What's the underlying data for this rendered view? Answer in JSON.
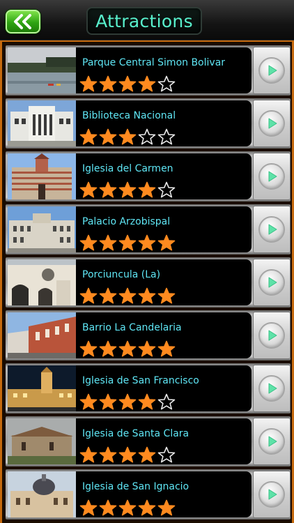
{
  "header": {
    "title": "Attractions",
    "back_icon": "double-chevron-left-icon"
  },
  "colors": {
    "accent_green": "#2ea412",
    "title_text": "#58f0cc",
    "name_text": "#5fe6f5",
    "star_fill": "#ff8a1f",
    "frame_orange": "#c56a0f"
  },
  "attractions": [
    {
      "name": "Parque Central Simon Bolivar",
      "rating": 4,
      "max_rating": 5
    },
    {
      "name": "Biblioteca Nacional",
      "rating": 3,
      "max_rating": 5
    },
    {
      "name": "Iglesia del Carmen",
      "rating": 4,
      "max_rating": 5
    },
    {
      "name": "Palacio Arzobispal",
      "rating": 5,
      "max_rating": 5
    },
    {
      "name": "Porciuncula (La)",
      "rating": 5,
      "max_rating": 5
    },
    {
      "name": "Barrio La Candelaria",
      "rating": 5,
      "max_rating": 5
    },
    {
      "name": "Iglesia de San Francisco",
      "rating": 4,
      "max_rating": 5
    },
    {
      "name": "Iglesia de Santa Clara",
      "rating": 4,
      "max_rating": 5
    },
    {
      "name": "Iglesia de San Ignacio",
      "rating": 5,
      "max_rating": 5
    }
  ]
}
